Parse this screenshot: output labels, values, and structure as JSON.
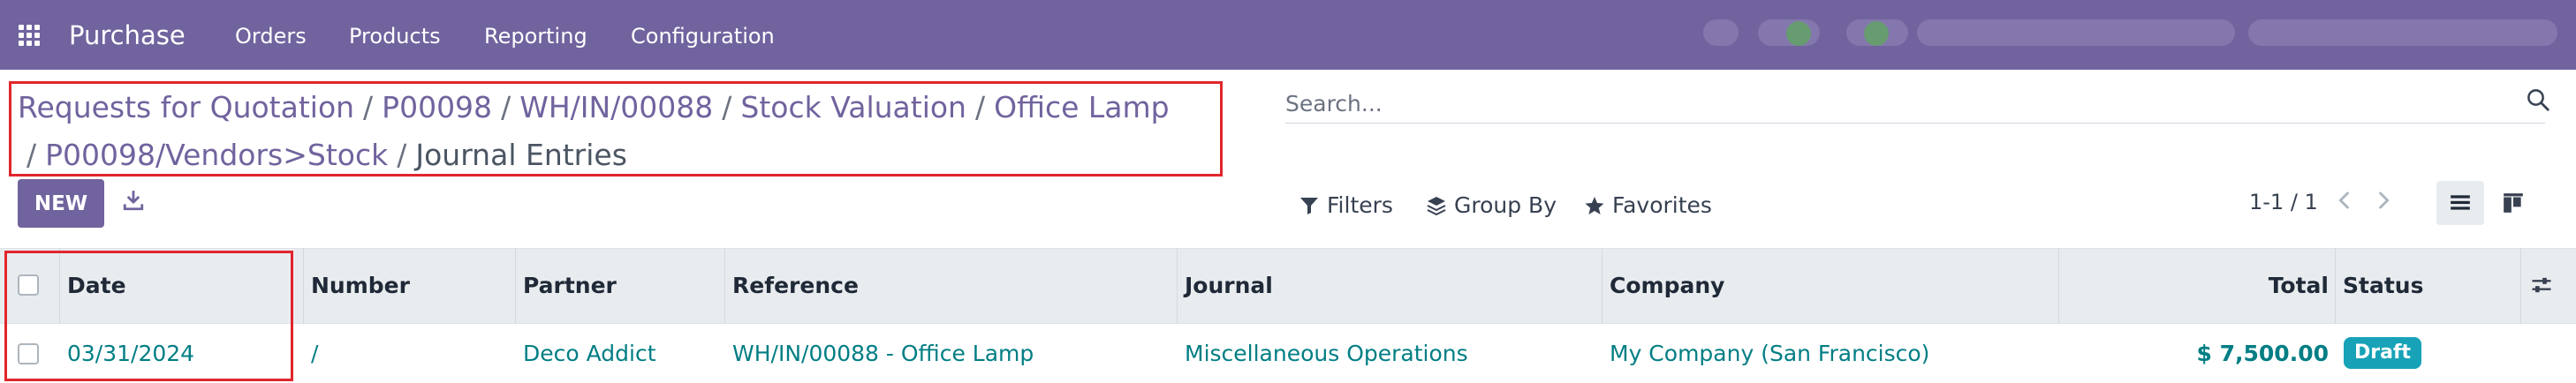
{
  "navbar": {
    "app_name": "Purchase",
    "menu": [
      "Orders",
      "Products",
      "Reporting",
      "Configuration"
    ],
    "apps_icon": "apps-grid-icon"
  },
  "breadcrumb": {
    "items": [
      "Requests for Quotation",
      "P00098",
      "WH/IN/00088",
      "Stock Valuation",
      "Office Lamp",
      "P00098/Vendors>Stock"
    ],
    "current": "Journal Entries",
    "separator": "/"
  },
  "search": {
    "placeholder": "Search...",
    "icon": "magnifier-icon"
  },
  "controls": {
    "new_label": "NEW",
    "download_icon": "download-icon",
    "filters_label": "Filters",
    "group_by_label": "Group By",
    "favorites_label": "Favorites",
    "pager_text": "1-1 / 1",
    "view_list_icon": "list-view-icon",
    "view_kanban_icon": "kanban-view-icon"
  },
  "table": {
    "columns": [
      "Date",
      "Number",
      "Partner",
      "Reference",
      "Journal",
      "Company",
      "Total",
      "Status"
    ],
    "rows": [
      {
        "date": "03/31/2024",
        "number": "/",
        "partner": "Deco Addict",
        "reference": "WH/IN/00088 - Office Lamp",
        "journal": "Miscellaneous Operations",
        "company": "My Company (San Francisco)",
        "total": "$ 7,500.00",
        "status": "Draft"
      }
    ]
  },
  "colors": {
    "brand": "#71639e",
    "link": "#017e84",
    "highlight": "#e0262c",
    "status_draft": "#17a2b8"
  }
}
